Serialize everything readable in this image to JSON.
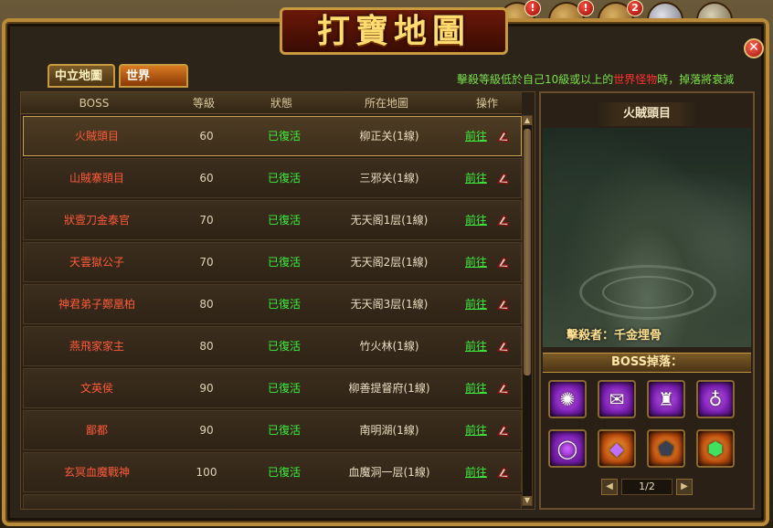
{
  "window": {
    "title": "打寶地圖",
    "close_label": "✕"
  },
  "hud": {
    "badges": [
      "!",
      "!",
      "2"
    ]
  },
  "tabs": [
    {
      "label": "中立地圖",
      "active": false
    },
    {
      "label": "世界Boss",
      "active": true
    }
  ],
  "notice": {
    "prefix": "擊殺等級低於自己10級或以上的",
    "highlight": "世界怪物",
    "suffix": "時，掉落將衰減"
  },
  "table": {
    "columns": [
      "BOSS",
      "等級",
      "狀態",
      "所在地圖",
      "操作"
    ],
    "rows": [
      {
        "name": "火賊頭目",
        "level": "60",
        "status": "已復活",
        "map": "柳正关(1線)",
        "action": "前往"
      },
      {
        "name": "山賊寨頭目",
        "level": "60",
        "status": "已復活",
        "map": "三邪关(1線)",
        "action": "前往"
      },
      {
        "name": "狀壹刀金泰官",
        "level": "70",
        "status": "已復活",
        "map": "无天阁1层(1線)",
        "action": "前往"
      },
      {
        "name": "天雲獄公子",
        "level": "70",
        "status": "已復活",
        "map": "无天阁2层(1線)",
        "action": "前往"
      },
      {
        "name": "神君弟子鄭凰柏",
        "level": "80",
        "status": "已復活",
        "map": "无天阁3层(1線)",
        "action": "前往"
      },
      {
        "name": "燕飛家家主",
        "level": "80",
        "status": "已復活",
        "map": "竹火林(1線)",
        "action": "前往"
      },
      {
        "name": "文英侯",
        "level": "90",
        "status": "已復活",
        "map": "柳善提督府(1線)",
        "action": "前往"
      },
      {
        "name": "鄙都",
        "level": "90",
        "status": "已復活",
        "map": "南明湖(1線)",
        "action": "前往"
      },
      {
        "name": "玄冥血魔戰神",
        "level": "100",
        "status": "已復活",
        "map": "血魔洞一层(1線)",
        "action": "前往"
      }
    ]
  },
  "boss_panel": {
    "name": "火賊頭目",
    "killer": "擊殺者：千金埋骨",
    "drops_label": "BOSS掉落：",
    "items": [
      {
        "icon": "purple-orb-icon",
        "rarity": "purple",
        "glyph": "✺"
      },
      {
        "icon": "scroll-icon",
        "rarity": "purple",
        "glyph": "✉"
      },
      {
        "icon": "boots-icon",
        "rarity": "purple",
        "glyph": "♜"
      },
      {
        "icon": "necklace-icon",
        "rarity": "purple",
        "glyph": "♁"
      },
      {
        "icon": "ring-icon",
        "rarity": "purple",
        "glyph": "◯"
      },
      {
        "icon": "gem-purple-icon",
        "rarity": "orange",
        "glyph": "◆"
      },
      {
        "icon": "gem-dark-icon",
        "rarity": "orange",
        "glyph": "⬟"
      },
      {
        "icon": "gem-green-icon",
        "rarity": "orange",
        "glyph": "⬢"
      }
    ],
    "page": "1/2"
  },
  "colors": {
    "boss_name": "#ff5a3a",
    "status_alive": "#3cf03c",
    "notice": "#7ae04a",
    "notice_highlight": "#ff3030"
  }
}
